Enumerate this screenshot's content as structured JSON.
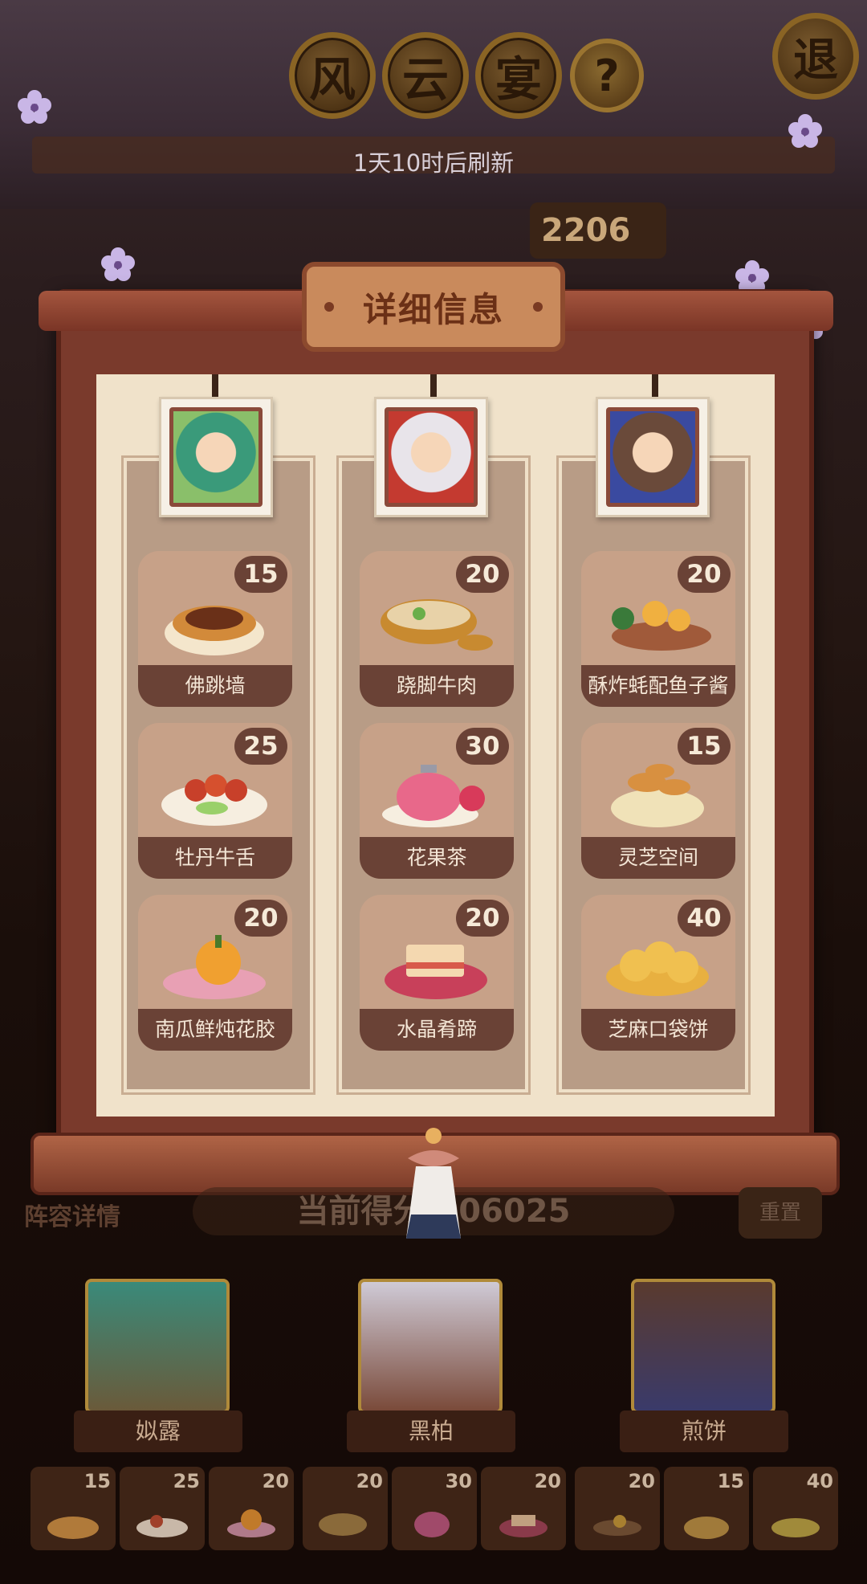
{
  "header": {
    "title_chars": [
      "风",
      "云",
      "宴"
    ],
    "help": "?",
    "exit": "退",
    "refresh_text": "1天10时后刷新",
    "score_partial": "2206"
  },
  "panel": {
    "title": "详细信息",
    "columns": [
      {
        "character": "姒露",
        "dishes": [
          {
            "name": "佛跳墙",
            "count": "15"
          },
          {
            "name": "牡丹牛舌",
            "count": "25"
          },
          {
            "name": "南瓜鲜炖花胶",
            "count": "20"
          }
        ]
      },
      {
        "character": "黑柏",
        "dishes": [
          {
            "name": "跷脚牛肉",
            "count": "20"
          },
          {
            "name": "花果茶",
            "count": "30"
          },
          {
            "name": "水晶肴蹄",
            "count": "20"
          }
        ]
      },
      {
        "character": "煎饼",
        "dishes": [
          {
            "name": "酥炸蚝配鱼子酱",
            "count": "20"
          },
          {
            "name": "灵芝空间",
            "count": "15"
          },
          {
            "name": "芝麻口袋饼",
            "count": "40"
          }
        ]
      }
    ]
  },
  "lower": {
    "lineup_label": "阵容详情",
    "current_score": "当前得分 006025",
    "reset": "重置",
    "characters": [
      "姒露",
      "黑柏",
      "煎饼"
    ],
    "slots": [
      "15",
      "25",
      "20",
      "20",
      "30",
      "20",
      "20",
      "15",
      "40"
    ]
  },
  "colors": {
    "panel_frame": "#7a3a2c",
    "card_bg": "#c7a188",
    "card_label": "#6a4236",
    "parchment": "#f0e2ca"
  }
}
